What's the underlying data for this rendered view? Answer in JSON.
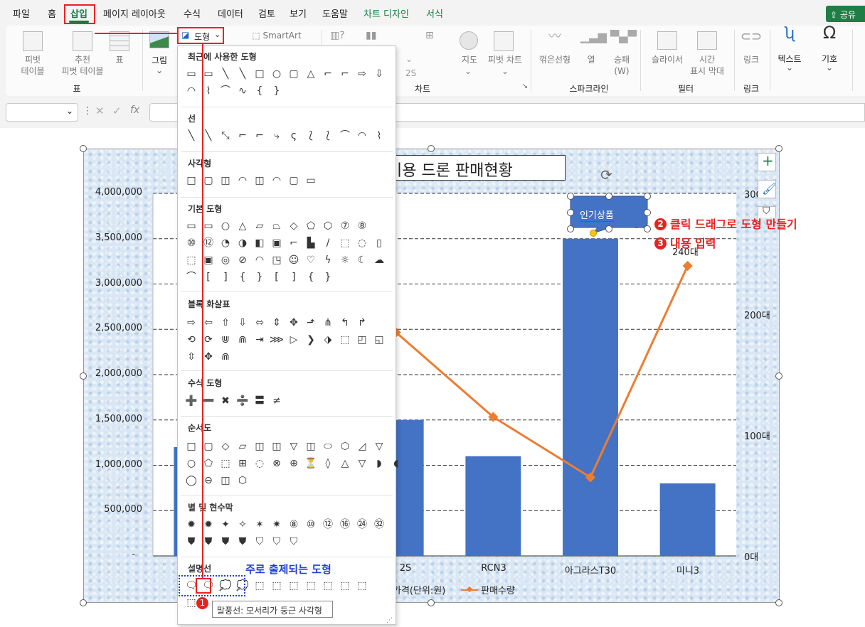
{
  "tabs": [
    "파일",
    "홈",
    "삽입",
    "페이지 레이아웃",
    "수식",
    "데이터",
    "검토",
    "보기",
    "도움말",
    "차트 디자인",
    "서식"
  ],
  "share_label": "공유",
  "ribbon": {
    "pivot": "피벗\n테이블",
    "rec_pivot": "추천\n피벗 테이블",
    "table": "표",
    "group_table": "표",
    "pictures": "그림",
    "shapes_btn": "도형",
    "smartart": "SmartArt",
    "maps": "지도",
    "pivot_chart": "피벗 차트",
    "group_chart": "차트",
    "spark_line": "꺾은선형",
    "spark_col": "열",
    "spark_wl": "승패\n(W)",
    "group_spark": "스파크라인",
    "slicer": "슬라이서",
    "timeline": "시간\n표시 막대",
    "group_filter": "필터",
    "link": "링크",
    "group_link": "링크",
    "text": "텍스트",
    "symbol": "기호"
  },
  "formula_fx": "fx",
  "shapes_menu": {
    "sections": [
      "최근에 사용한 도형",
      "선",
      "사각형",
      "기본 도형",
      "블록 화살표",
      "수식 도형",
      "순서도",
      "별 및 현수막",
      "설명선"
    ],
    "frequent_label": "주로 출제되는 도형",
    "tooltip": "말풍선: 모서리가 둥근 사각형"
  },
  "chart": {
    "title": "미용 드론 판매현황",
    "callout_text": "인기상품",
    "data_label_240": "240대",
    "legend_bar": "가격(단위:원)",
    "legend_line": "판매수량",
    "y_ticks": [
      "4,000,000",
      "3,500,000",
      "3,000,000",
      "2,500,000",
      "2,000,000",
      "1,500,000",
      "1,000,000",
      "500,000",
      "-"
    ],
    "y2_ticks": [
      "300대",
      "200대",
      "100대",
      "0대"
    ],
    "x_visible": [
      "2S",
      "RCN3",
      "아그라스T30",
      "미니3"
    ]
  },
  "chart_data": {
    "type": "bar",
    "categories": [
      "",
      "",
      "2S",
      "RCN3",
      "아그라스T30",
      "미니3"
    ],
    "series": [
      {
        "name": "가격(단위:원)",
        "type": "bar",
        "values": [
          1200000,
          null,
          1500000,
          1100000,
          3500000,
          800000
        ]
      },
      {
        "name": "판매수량",
        "type": "line",
        "axis": "secondary",
        "values": [
          null,
          null,
          185,
          115,
          65,
          240
        ]
      }
    ],
    "ylim": [
      0,
      4000000
    ],
    "y2lim": [
      0,
      300
    ],
    "grid": true
  },
  "annotations": {
    "step1": "1",
    "step2_num": "2",
    "step2": "클릭 드래그로 도형 만들기",
    "step3_num": "3",
    "step3": "내용 입력"
  },
  "colors": {
    "accent": "#107c41",
    "red": "#e8231f",
    "bar": "#4472c4",
    "line": "#ed7d31",
    "blue_text": "#1f3fd6"
  }
}
